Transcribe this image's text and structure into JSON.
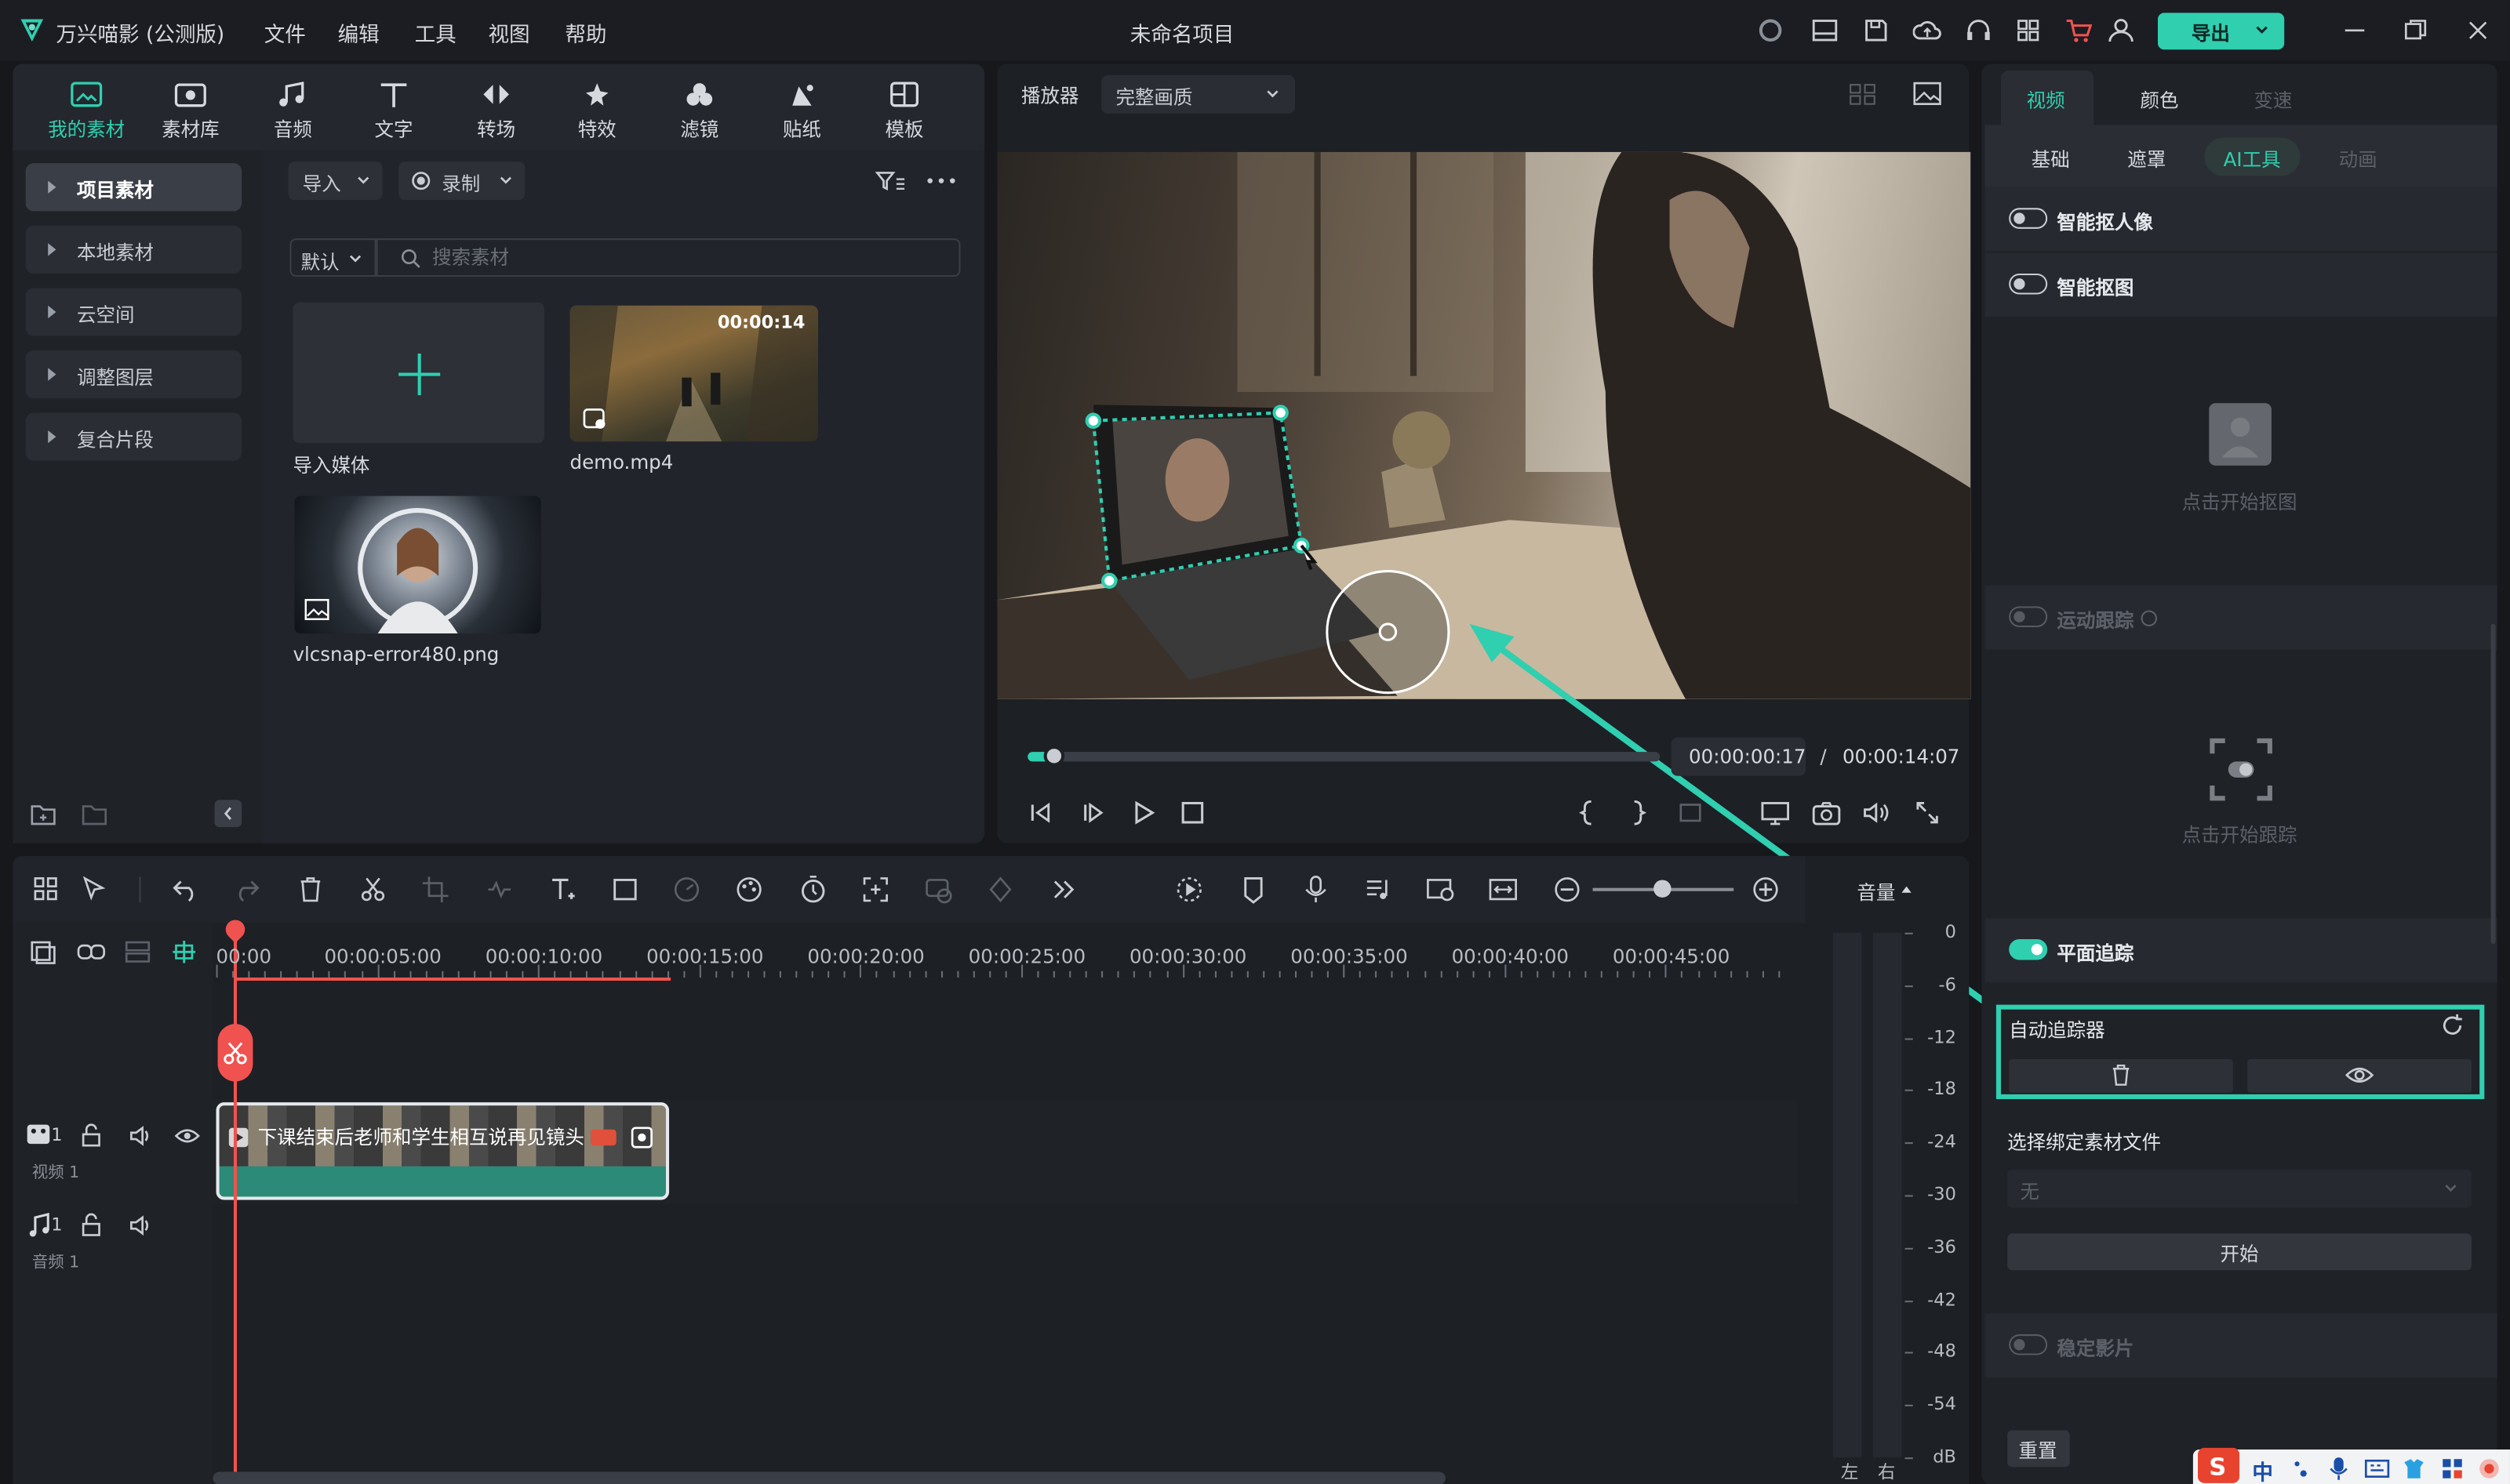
{
  "app": {
    "name": "万兴喵影 (公测版)",
    "project_title": "未命名项目",
    "export_label": "导出"
  },
  "menu": [
    "文件",
    "编辑",
    "工具",
    "视图",
    "帮助"
  ],
  "media_tabs": [
    {
      "label": "我的素材",
      "icon": "my-media-icon",
      "active": true
    },
    {
      "label": "素材库",
      "icon": "stock-library-icon"
    },
    {
      "label": "音频",
      "icon": "music-note-icon"
    },
    {
      "label": "文字",
      "icon": "text-icon"
    },
    {
      "label": "转场",
      "icon": "transition-icon"
    },
    {
      "label": "特效",
      "icon": "effects-icon"
    },
    {
      "label": "滤镜",
      "icon": "filter-icon"
    },
    {
      "label": "贴纸",
      "icon": "sticker-icon"
    },
    {
      "label": "模板",
      "icon": "template-icon"
    }
  ],
  "sidebar": {
    "items": [
      "项目素材",
      "本地素材",
      "云空间",
      "调整图层",
      "复合片段"
    ]
  },
  "library": {
    "import_label": "导入",
    "record_label": "录制",
    "sort_label": "默认",
    "search_placeholder": "搜索素材",
    "items": [
      {
        "name": "导入媒体"
      },
      {
        "name": "demo.mp4",
        "duration": "00:00:14"
      },
      {
        "name": "vlcsnap-error480.png"
      }
    ]
  },
  "player": {
    "label": "播放器",
    "quality": "完整画质",
    "current_time": "00:00:00:17",
    "separator": "/",
    "total_time": "00:00:14:07",
    "progress": 0.04
  },
  "right_panel": {
    "tabs": [
      "视频",
      "颜色",
      "变速"
    ],
    "subtabs": [
      "基础",
      "遮罩",
      "AI工具",
      "动画"
    ],
    "smart_portrait": "智能抠人像",
    "smart_cutout": "智能抠图",
    "cutout_hint": "点击开始抠图",
    "motion_tracking": "运动跟踪",
    "tracking_hint": "点击开始跟踪",
    "planar_tracking": "平面追踪",
    "auto_tracker": "自动追踪器",
    "bind_label": "选择绑定素材文件",
    "bind_value": "无",
    "start_label": "开始",
    "stabilize_label": "稳定影片",
    "reset_label": "重置"
  },
  "timeline": {
    "volume_label": "音量",
    "ruler": [
      "00:00",
      "00:00:05:00",
      "00:00:10:00",
      "00:00:15:00",
      "00:00:20:00",
      "00:00:25:00",
      "00:00:30:00",
      "00:00:35:00",
      "00:00:40:00",
      "00:00:45:00"
    ],
    "clip_title": "下课结束后老师和学生相互说再见镜头",
    "video_track": {
      "number": "1",
      "label": "视频 1"
    },
    "audio_track": {
      "number": "1",
      "label": "音频 1"
    },
    "db_scale": [
      "0",
      "-6",
      "-12",
      "-18",
      "-24",
      "-30",
      "-36",
      "-42",
      "-48",
      "-54",
      "dB"
    ],
    "lr_labels": [
      "左",
      "右"
    ]
  },
  "ime": {
    "lang": "中"
  },
  "colors": {
    "accent": "#2fcfb0",
    "playhead": "#f0524f",
    "background": "#16181c"
  }
}
